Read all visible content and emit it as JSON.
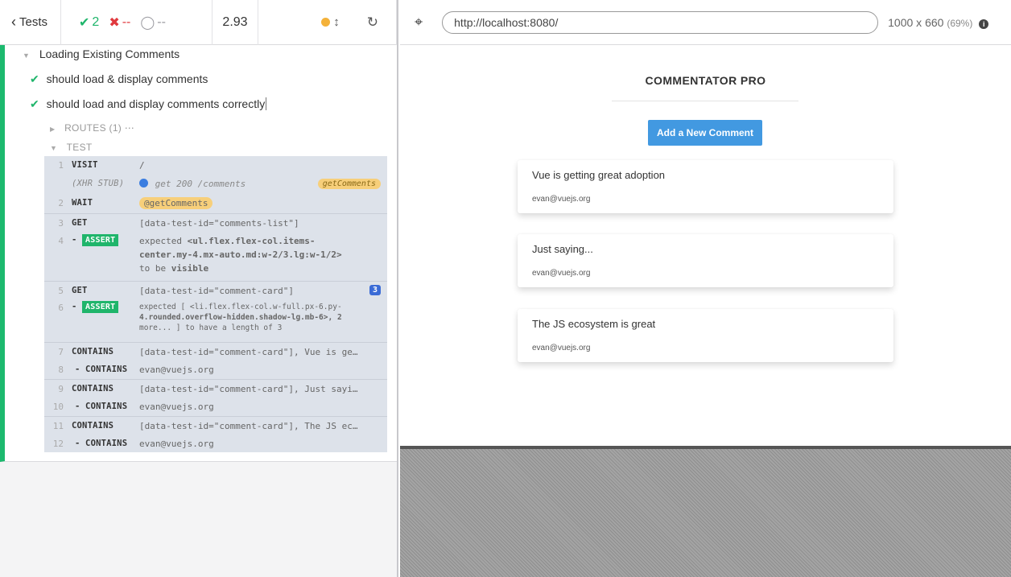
{
  "reporter": {
    "header": {
      "tests_label": "Tests",
      "passed_count": "2",
      "failed_count": "--",
      "pending_count": "--",
      "duration": "2.93"
    },
    "suite_title": "Loading Existing Comments",
    "tests": [
      {
        "title": "should load & display comments"
      },
      {
        "title": "should load and display comments correctly"
      }
    ],
    "routes_label": "ROUTES (1)",
    "test_label": "TEST",
    "commands": [
      {
        "num": "1",
        "name": "VISIT",
        "msg": "/"
      },
      {
        "num": "",
        "name": "(XHR STUB)",
        "method": "get",
        "status": "200",
        "path": "/comments",
        "alias": "getComments"
      },
      {
        "num": "2",
        "name": "WAIT",
        "msg": "@getComments"
      },
      {
        "num": "3",
        "name": "GET",
        "msg": "[data-test-id=\"comments-list\"]"
      },
      {
        "num": "4",
        "name": "- ASSERT",
        "line1_prefix": "expected",
        "line1_el": "<ul.flex.flex-col.items-",
        "line2": "center.my-4.mx-auto.md:w-2/3.lg:w-1/2>",
        "line3_prefix": "to be",
        "line3_word": "visible"
      },
      {
        "num": "5",
        "name": "GET",
        "msg": "[data-test-id=\"comment-card\"]",
        "count": "3"
      },
      {
        "num": "6",
        "name": "- ASSERT",
        "line1": "expected [ <li.flex.flex-col.w-full.px-6.py-",
        "line2": "4.rounded.overflow-hidden.shadow-lg.mb-6>, 2",
        "line3": "more... ] to have a length of 3"
      },
      {
        "num": "7",
        "name": "CONTAINS",
        "msg": "[data-test-id=\"comment-card\"], Vue is ge…"
      },
      {
        "num": "8",
        "name": "- CONTAINS",
        "msg": "evan@vuejs.org"
      },
      {
        "num": "9",
        "name": "CONTAINS",
        "msg": "[data-test-id=\"comment-card\"], Just sayi…"
      },
      {
        "num": "10",
        "name": "- CONTAINS",
        "msg": "evan@vuejs.org"
      },
      {
        "num": "11",
        "name": "CONTAINS",
        "msg": "[data-test-id=\"comment-card\"], The JS ec…"
      },
      {
        "num": "12",
        "name": "- CONTAINS",
        "msg": "evan@vuejs.org"
      }
    ]
  },
  "aut": {
    "url": "http://localhost:8080/",
    "viewport": "1000 x 660",
    "scale": "(69%)",
    "app_title": "COMMENTATOR PRO",
    "add_button": "Add a New Comment",
    "comments": [
      {
        "text": "Vue is getting great adoption",
        "author": "evan@vuejs.org"
      },
      {
        "text": "Just saying...",
        "author": "evan@vuejs.org"
      },
      {
        "text": "The JS ecosystem is great",
        "author": "evan@vuejs.org"
      }
    ]
  },
  "colors": {
    "pass_green": "#1fb56b",
    "fail_red": "#e0393e",
    "button_blue": "#4299e1",
    "alias_yellow": "#f7cf7a"
  },
  "icons": {
    "back": "chevron-left-icon",
    "passed": "check-icon",
    "failed": "x-icon",
    "pending": "circle-icon",
    "running": "dot-icon",
    "scroll": "vertical-arrows-icon",
    "restart": "reload-icon",
    "selector": "crosshair-icon",
    "info": "info-icon"
  }
}
